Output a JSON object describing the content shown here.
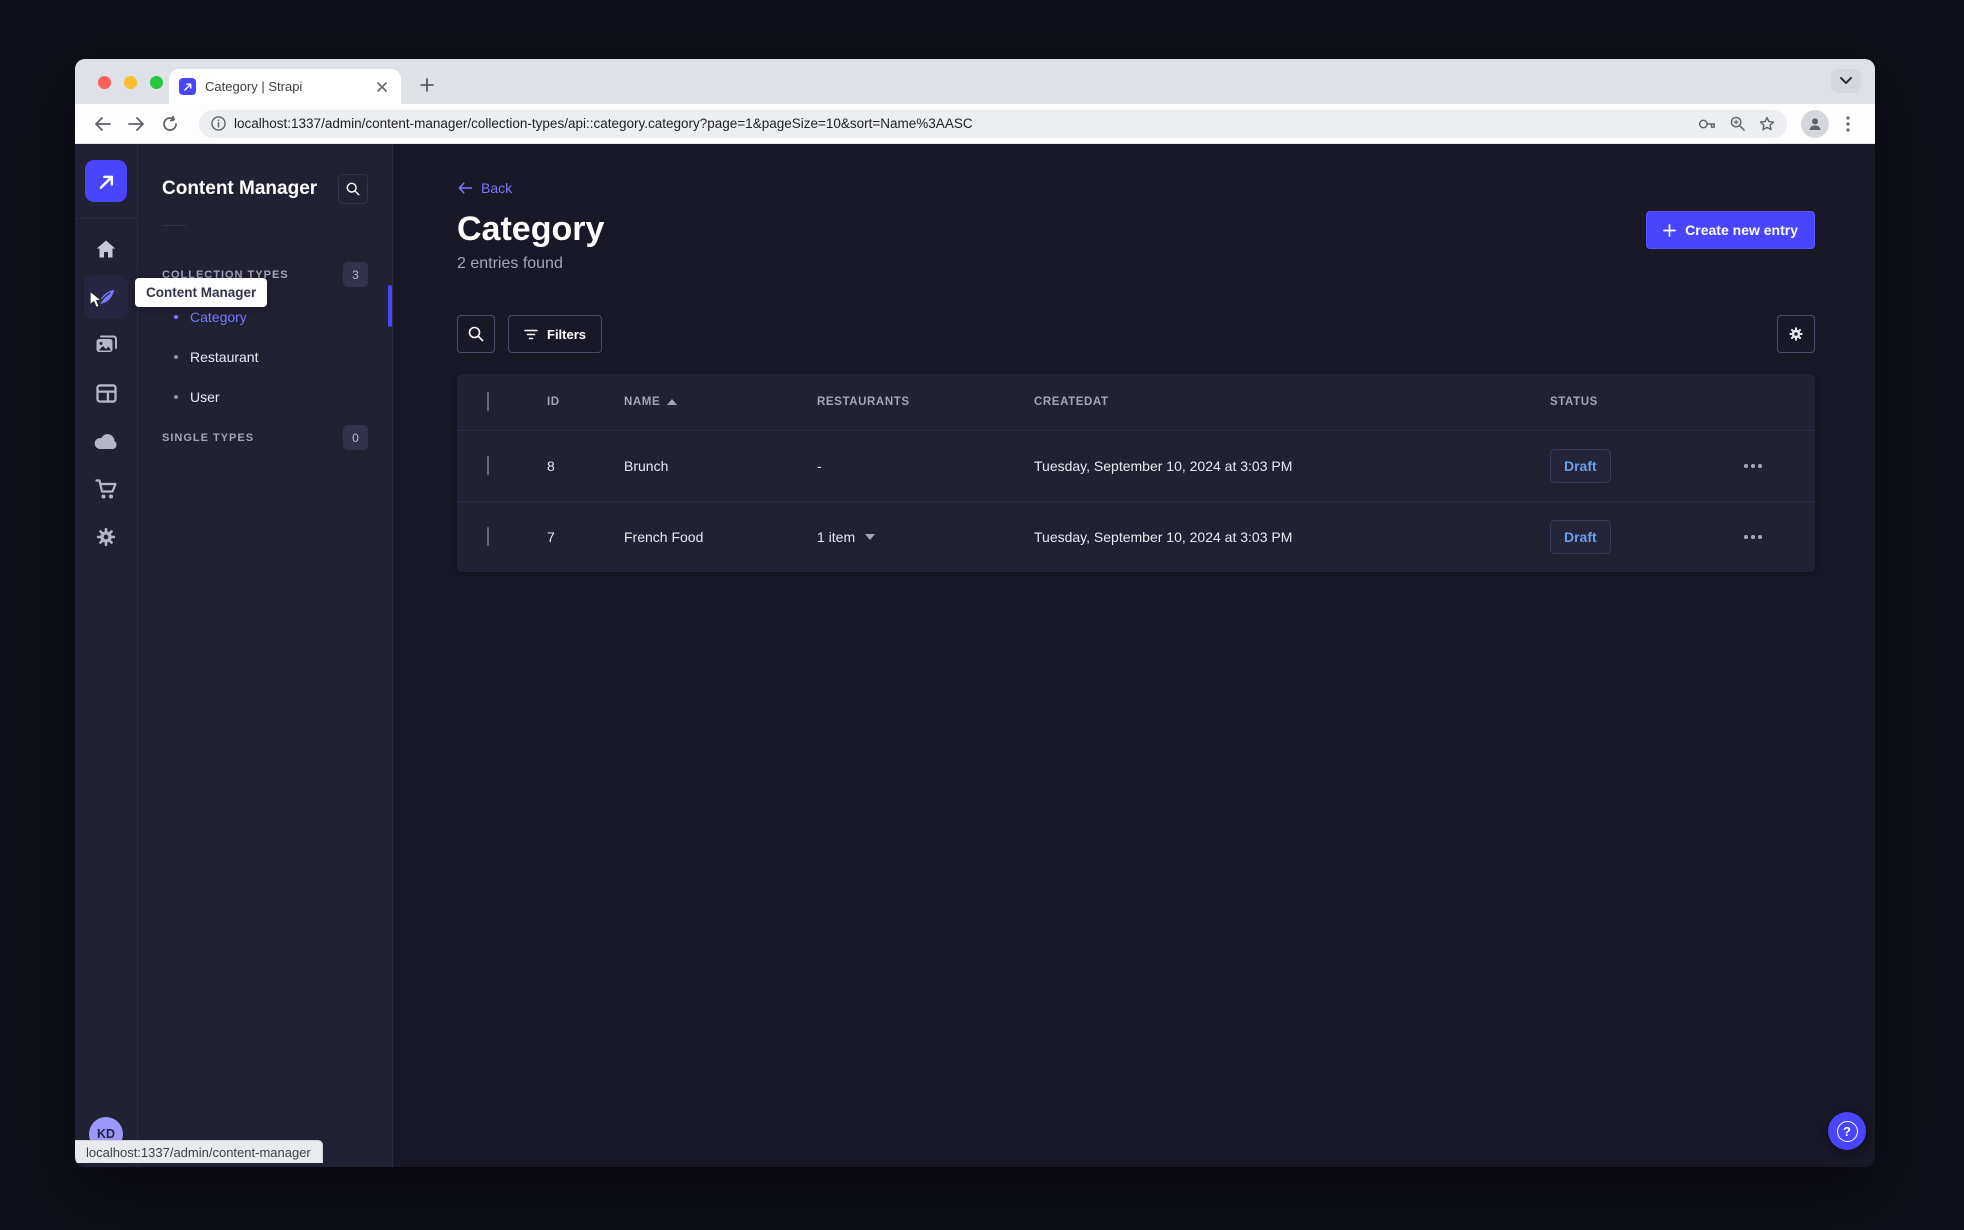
{
  "browser": {
    "tab_title": "Category | Strapi",
    "url": "localhost:1337/admin/content-manager/collection-types/api::category.category?page=1&pageSize=10&sort=Name%3AASC",
    "status_bar_url": "localhost:1337/admin/content-manager"
  },
  "icons": {
    "question_mark": "?"
  },
  "rail": {
    "user_initials": "KD",
    "tooltip": "Content Manager"
  },
  "subnav": {
    "title": "Content Manager",
    "sections": [
      {
        "label": "COLLECTION TYPES",
        "badge": "3"
      },
      {
        "label": "SINGLE TYPES",
        "badge": "0"
      }
    ],
    "items": [
      {
        "label": "Category"
      },
      {
        "label": "Restaurant"
      },
      {
        "label": "User"
      }
    ]
  },
  "main": {
    "back_label": "Back",
    "title": "Category",
    "subtitle": "2 entries found",
    "create_button_label": "Create new entry",
    "filters_button_label": "Filters",
    "table": {
      "columns": [
        "ID",
        "NAME",
        "RESTAURANTS",
        "CREATEDAT",
        "STATUS"
      ],
      "rows": [
        {
          "id": "8",
          "name": "Brunch",
          "restaurants": "-",
          "createdat": "Tuesday, September 10, 2024 at 3:03 PM",
          "status": "Draft"
        },
        {
          "id": "7",
          "name": "French Food",
          "restaurants": "1 item",
          "createdat": "Tuesday, September 10, 2024 at 3:03 PM",
          "status": "Draft"
        }
      ]
    }
  },
  "colors": {
    "accent": "#4945ff",
    "accent_light": "#7b79ff",
    "draft_text": "#6ba0e8",
    "panel_bg": "#212134",
    "page_bg": "#181826"
  }
}
